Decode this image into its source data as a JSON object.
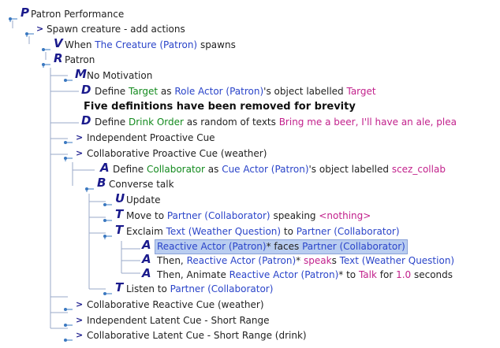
{
  "tree": {
    "n0": {
      "letter": "P",
      "parts": [
        {
          "t": "Patron Performance",
          "c": "dark"
        }
      ]
    },
    "n1": {
      "letter": ">",
      "parts": [
        {
          "t": "Spawn creature - add actions",
          "c": "dark"
        }
      ]
    },
    "n2": {
      "letter": "V",
      "parts": [
        {
          "t": "When ",
          "c": "dark"
        },
        {
          "t": "The Creature (Patron)",
          "c": "blue"
        },
        {
          "t": " spawns",
          "c": "dark"
        }
      ]
    },
    "n3": {
      "letter": "R",
      "parts": [
        {
          "t": "Patron",
          "c": "dark"
        }
      ]
    },
    "n4": {
      "letter": "M",
      "parts": [
        {
          "t": "No Motivation",
          "c": "dark"
        }
      ]
    },
    "n5": {
      "letter": "D",
      "parts": [
        {
          "t": "Define ",
          "c": "dark"
        },
        {
          "t": "Target",
          "c": "green"
        },
        {
          "t": " as ",
          "c": "dark"
        },
        {
          "t": "Role Actor (Patron)",
          "c": "blue"
        },
        {
          "t": "'s object labelled ",
          "c": "dark"
        },
        {
          "t": "Target",
          "c": "magenta"
        }
      ]
    },
    "n6": {
      "letter": "",
      "parts": [
        {
          "t": "Five definitions have been removed for brevity",
          "c": "bold"
        }
      ]
    },
    "n7": {
      "letter": "D",
      "parts": [
        {
          "t": "Define ",
          "c": "dark"
        },
        {
          "t": "Drink Order",
          "c": "green"
        },
        {
          "t": " as random of texts ",
          "c": "dark"
        },
        {
          "t": "Bring me a beer, I'll have an ale, plea",
          "c": "magenta"
        }
      ]
    },
    "n8": {
      "letter": ">",
      "parts": [
        {
          "t": "Independent Proactive Cue",
          "c": "dark"
        }
      ]
    },
    "n9": {
      "letter": ">",
      "parts": [
        {
          "t": "Collaborative Proactive Cue (weather)",
          "c": "dark"
        }
      ]
    },
    "n10": {
      "letter": "A",
      "parts": [
        {
          "t": "Define ",
          "c": "dark"
        },
        {
          "t": "Collaborator",
          "c": "green"
        },
        {
          "t": " as ",
          "c": "dark"
        },
        {
          "t": "Cue Actor (Patron)",
          "c": "blue"
        },
        {
          "t": "'s object labelled ",
          "c": "dark"
        },
        {
          "t": "scez_collab",
          "c": "magenta"
        }
      ]
    },
    "n11": {
      "letter": "B",
      "parts": [
        {
          "t": "Converse talk",
          "c": "dark"
        }
      ]
    },
    "n12": {
      "letter": "U",
      "parts": [
        {
          "t": "Update",
          "c": "dark"
        }
      ]
    },
    "n13": {
      "letter": "T",
      "parts": [
        {
          "t": "Move to ",
          "c": "dark"
        },
        {
          "t": "Partner (Collaborator)",
          "c": "blue"
        },
        {
          "t": " speaking ",
          "c": "dark"
        },
        {
          "t": "<nothing>",
          "c": "magenta"
        }
      ]
    },
    "n14": {
      "letter": "T",
      "parts": [
        {
          "t": "Exclaim ",
          "c": "dark"
        },
        {
          "t": "Text (Weather Question)",
          "c": "blue"
        },
        {
          "t": " to ",
          "c": "dark"
        },
        {
          "t": "Partner (Collaborator)",
          "c": "blue"
        }
      ]
    },
    "n15": {
      "letter": "A",
      "parts": [
        {
          "t": "Reactive Actor (Patron)",
          "c": "blue"
        },
        {
          "t": "* faces ",
          "c": "dark"
        },
        {
          "t": "Partner (Collaborator)",
          "c": "blue"
        }
      ]
    },
    "n16": {
      "letter": "A",
      "parts": [
        {
          "t": "Then, ",
          "c": "dark"
        },
        {
          "t": "Reactive Actor (Patron)",
          "c": "blue"
        },
        {
          "t": "* ",
          "c": "dark"
        },
        {
          "t": "speak",
          "c": "magenta"
        },
        {
          "t": "s ",
          "c": "dark"
        },
        {
          "t": "Text (Weather Question)",
          "c": "blue"
        }
      ]
    },
    "n17": {
      "letter": "A",
      "parts": [
        {
          "t": "Then, Animate ",
          "c": "dark"
        },
        {
          "t": "Reactive Actor (Patron)",
          "c": "blue"
        },
        {
          "t": "* to ",
          "c": "dark"
        },
        {
          "t": "Talk",
          "c": "magenta"
        },
        {
          "t": " for ",
          "c": "dark"
        },
        {
          "t": "1.0",
          "c": "magenta"
        },
        {
          "t": " seconds",
          "c": "dark"
        }
      ]
    },
    "n18": {
      "letter": "T",
      "parts": [
        {
          "t": "Listen to ",
          "c": "dark"
        },
        {
          "t": "Partner (Collaborator)",
          "c": "blue"
        }
      ]
    },
    "n19": {
      "letter": ">",
      "parts": [
        {
          "t": "Collaborative Reactive Cue (weather)",
          "c": "dark"
        }
      ]
    },
    "n20": {
      "letter": ">",
      "parts": [
        {
          "t": "Independent Latent Cue - Short Range",
          "c": "dark"
        }
      ]
    },
    "n21": {
      "letter": ">",
      "parts": [
        {
          "t": "Collaborative Latent Cue - Short Range (drink)",
          "c": "dark"
        }
      ]
    }
  },
  "colors": {
    "tree_line": "#9aa8c8",
    "toggle": "#3a78c0",
    "selection": "#b9cdf0"
  }
}
